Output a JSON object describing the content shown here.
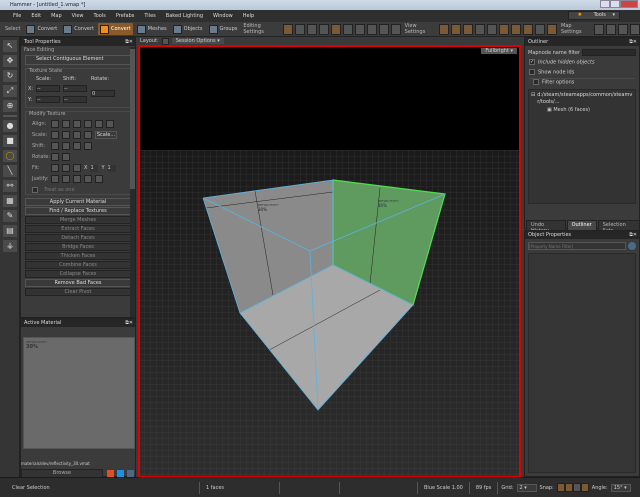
{
  "window": {
    "title": "Hammer - [untitled_1.vmap *]"
  },
  "menu": [
    "File",
    "Edit",
    "Map",
    "View",
    "Tools",
    "Prefabs",
    "Tiles",
    "Baked Lighting",
    "Window",
    "Help"
  ],
  "toolbar": {
    "select_label": "Select",
    "modes": [
      {
        "label": "Convert",
        "active": false
      },
      {
        "label": "Convert",
        "active": false
      },
      {
        "label": "Convert",
        "active": true
      },
      {
        "label": "Meshes",
        "active": false
      },
      {
        "label": "Objects",
        "active": false
      },
      {
        "label": "Groups",
        "active": false
      }
    ],
    "editing_settings": "Editing Settings",
    "view_settings": "View Settings",
    "map_settings": "Map Settings",
    "tools_button": "Tools"
  },
  "tool_properties": {
    "title": "Tool Properties",
    "section": "Face Editing",
    "select_contiguous": "Select Contiguous Element",
    "texture_state": "Texture State",
    "scale": "Scale:",
    "shift": "Shift:",
    "rotate": "Rotate:",
    "x": "X:",
    "y": "Y:",
    "field_value": "--",
    "rotate_value": "0",
    "modify_texture": "Modify Texture",
    "align": "Align:",
    "scale2": "Scale:",
    "scale_button": "Scale...",
    "shift2": "Shift:",
    "rotate2": "Rotate:",
    "fit": "Fit:",
    "fit_x": "X",
    "fit_y": "Y",
    "fit_value": "1",
    "justify": "Justify:",
    "treat_as_one": "Treat as one",
    "buttons": [
      {
        "label": "Apply Current Material",
        "enabled": true
      },
      {
        "label": "Find / Replace Textures",
        "enabled": true
      },
      {
        "label": "Merge Meshes",
        "enabled": false
      },
      {
        "label": "Extract Faces",
        "enabled": false
      },
      {
        "label": "Detach Faces",
        "enabled": false
      },
      {
        "label": "Bridge Faces",
        "enabled": false
      },
      {
        "label": "Thicken Faces",
        "enabled": false
      },
      {
        "label": "Combine Faces",
        "enabled": false
      },
      {
        "label": "Collapse Faces",
        "enabled": false
      },
      {
        "label": "Remove Bad Faces",
        "enabled": true
      },
      {
        "label": "Clear Pivot",
        "enabled": false
      }
    ]
  },
  "active_material": {
    "title": "Active Material",
    "preview_label": "REFLECTIVITY",
    "preview_value": "30%",
    "path": "materials/dev/reflectivity_30.vmat",
    "browse": "Browse"
  },
  "viewport": {
    "layout_label": "Layout:",
    "session_options": "Session Options",
    "render_mode": "Fullbright",
    "face_label": "REFLECTIVITY",
    "face_value": "30%",
    "colors": {
      "selection_border": "#e00000",
      "selected_face": "#4fa04f",
      "edges": "#5ab4e0"
    }
  },
  "outliner": {
    "title": "Outliner",
    "filter_label": "Mapnode name filter",
    "include_hidden": "Include hidden objects",
    "include_hidden_checked": true,
    "show_node_ids": "Show node ids",
    "filter_options": "Filter options",
    "root": "d:/steam/steamapps/common/steamvr/tools/...",
    "child": "Mesh (6 faces)",
    "tabs": [
      {
        "label": "Undo History",
        "active": false
      },
      {
        "label": "Outliner",
        "active": true
      },
      {
        "label": "Selection Sets",
        "active": false
      }
    ]
  },
  "object_properties": {
    "title": "Object Properties",
    "filter_placeholder": "[Property Name Filter]"
  },
  "status": {
    "clear_selection": "Clear Selection",
    "faces": "1 faces",
    "blue_scale": "Blue Scale 1.00",
    "fps": "89 fps",
    "grid_label": "Grid:",
    "grid_value": "2",
    "snap_label": "Snap:",
    "angle_label": "Angle:",
    "angle_value": "15°"
  }
}
